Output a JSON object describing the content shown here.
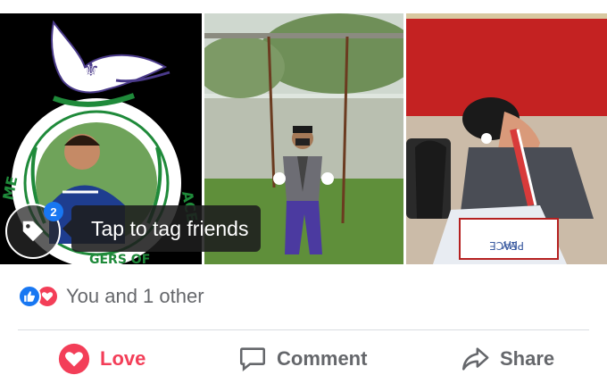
{
  "photos": [
    {
      "description_icon": "photo-scout-badge-portrait"
    },
    {
      "description_icon": "photo-scout-on-swing"
    },
    {
      "description_icon": "photo-scout-drawing"
    }
  ],
  "badge_text": "MESSENGERS OF PEACE",
  "tag": {
    "count": "2",
    "tooltip": "Tap to tag friends"
  },
  "reactions": {
    "summary": "You and 1 other",
    "icons": [
      "like-icon",
      "love-icon"
    ]
  },
  "actions": {
    "love_label": "Love",
    "comment_label": "Comment",
    "share_label": "Share"
  },
  "colors": {
    "love": "#f33e58",
    "like": "#1877f2",
    "muted": "#65676b"
  }
}
